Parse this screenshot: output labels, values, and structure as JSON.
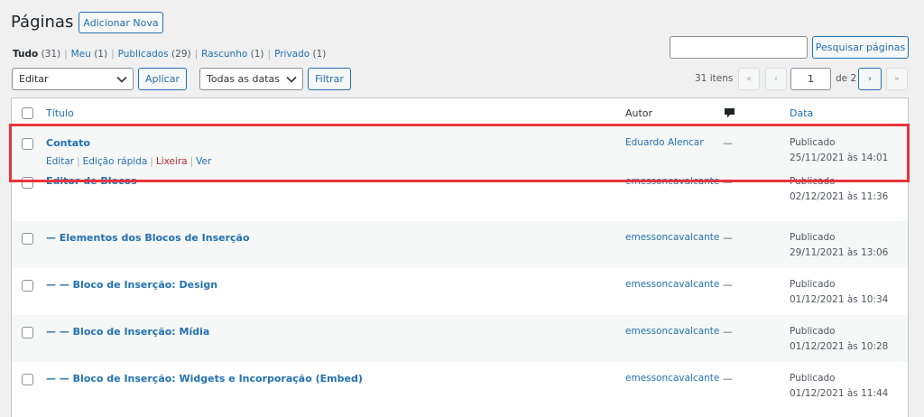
{
  "header": {
    "title": "Páginas",
    "add_new_label": "Adicionar Nova"
  },
  "views": [
    {
      "label": "Tudo",
      "count": "(31)"
    },
    {
      "label": "Meu",
      "count": "(1)"
    },
    {
      "label": "Publicados",
      "count": "(29)"
    },
    {
      "label": "Rascunho",
      "count": "(1)"
    },
    {
      "label": "Privado",
      "count": "(1)"
    }
  ],
  "search": {
    "button_label": "Pesquisar páginas",
    "value": ""
  },
  "bulk": {
    "selected": "Editar",
    "apply_label": "Aplicar"
  },
  "date_filter": {
    "selected": "Todas as datas",
    "filter_label": "Filtrar"
  },
  "pagination": {
    "items": "31 itens",
    "first": "«",
    "prev": "‹",
    "current": "1",
    "of": "de 2",
    "next": "›",
    "last": "»"
  },
  "columns": {
    "title": "Título",
    "author": "Autor",
    "date": "Data"
  },
  "row_actions": {
    "edit": "Editar",
    "quick_edit": "Edição rápida",
    "trash": "Lixeira",
    "view": "Ver"
  },
  "rows": [
    {
      "title": "Contato",
      "author": "Eduardo Alencar",
      "comments": "—",
      "status": "Publicado",
      "date": "25/11/2021 às 14:01"
    },
    {
      "title": "Editor de Blocos",
      "author": "emessoncavalcante",
      "comments": "—",
      "status": "Publicado",
      "date": "02/12/2021 às 11:36"
    },
    {
      "title": "— Elementos dos Blocos de Inserção",
      "author": "emessoncavalcante",
      "comments": "—",
      "status": "Publicado",
      "date": "29/11/2021 às 13:06"
    },
    {
      "title": "— — Bloco de Inserção: Design",
      "author": "emessoncavalcante",
      "comments": "—",
      "status": "Publicado",
      "date": "01/12/2021 às 10:34"
    },
    {
      "title": "— — Bloco de Inserção: Mídia",
      "author": "emessoncavalcante",
      "comments": "—",
      "status": "Publicado",
      "date": "01/12/2021 às 10:28"
    },
    {
      "title": "— — Bloco de Inserção: Widgets e Incorporação (Embed)",
      "author": "emessoncavalcante",
      "comments": "—",
      "status": "Publicado",
      "date": "01/12/2021 às 11:44"
    }
  ],
  "colors": {
    "link": "#2271b1",
    "highlight": "#e8333a",
    "trash": "#b32d2e"
  }
}
